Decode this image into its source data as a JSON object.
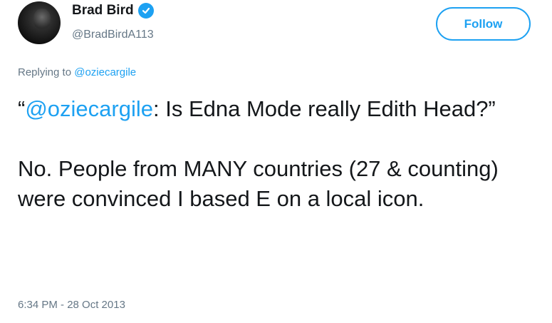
{
  "author": {
    "display_name": "Brad Bird",
    "handle": "@BradBirdA113",
    "verified": true
  },
  "follow_label": "Follow",
  "reply_context": {
    "prefix": "Replying to",
    "target": "@oziecargile"
  },
  "tweet": {
    "open_quote": "“",
    "mention": "@oziecargile",
    "quoted_text": ": Is Edna Mode really Edith Head?”",
    "body": "No. People from MANY countries (27 & counting) were convinced I based E on a local icon."
  },
  "timestamp": "6:34 PM - 28 Oct 2013",
  "colors": {
    "accent": "#1da1f2",
    "text": "#14171a",
    "muted": "#657786"
  },
  "icons": {
    "verified": "verified-badge-icon"
  }
}
